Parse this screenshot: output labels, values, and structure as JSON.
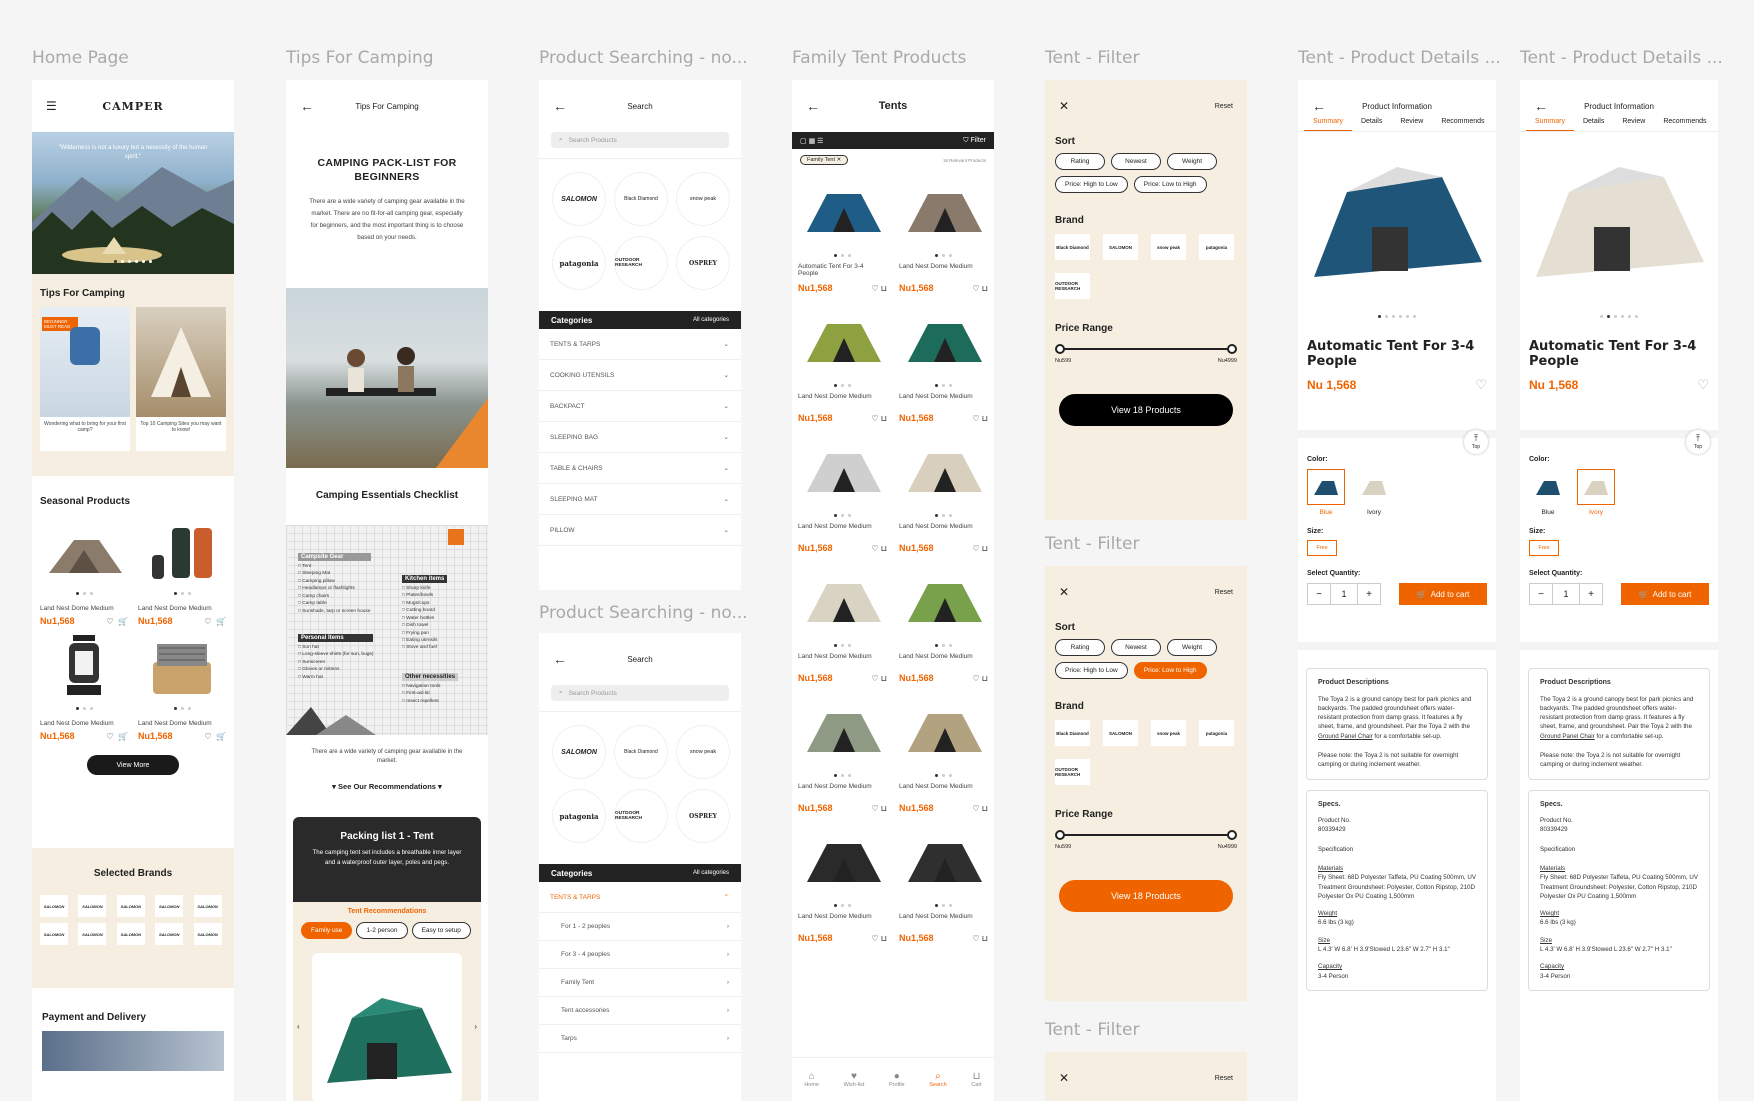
{
  "frame_titles": {
    "home": "Home Page",
    "tips": "Tips For Camping",
    "search1": "Product Searching - no...",
    "family": "Family Tent Products",
    "filter1": "Tent - Filter",
    "details1": "Tent - Product Details ...",
    "details2": "Tent - Product Details ...",
    "search2": "Product Searching - no...",
    "filter2": "Tent - Filter",
    "filter3": "Tent - Filter"
  },
  "home": {
    "logo": "CAMPER",
    "quote": "\"Wilderness is not a luxury but a necessity of the human spirit.\"",
    "tips_title": "Tips For Camping",
    "tip_badge": "BEGINNER MUST READ",
    "tip1_caption": "Wondering what to bring for your first camp?",
    "tip2_caption": "Top 10 Camping Sites you may want to know!",
    "seasonal_title": "Seasonal Products",
    "products": [
      {
        "name": "Land Nest Dome Medium",
        "price": "Nu1,568"
      },
      {
        "name": "Land Nest Dome Medium",
        "price": "Nu1,568"
      },
      {
        "name": "Land Nest Dome Medium",
        "price": "Nu1,568"
      },
      {
        "name": "Land Nest Dome Medium",
        "price": "Nu1,568"
      }
    ],
    "view_more": "View More",
    "brands_title": "Selected Brands",
    "brand_cell": "SALOMON",
    "payment_title": "Payment and Delivery"
  },
  "tips": {
    "header": "Tips For Camping",
    "h1": "CAMPING PACK-LIST FOR BEGINNERS",
    "intro": "There are a wide variety of camping gear available in the market. There are no fit-for-all camping gear, especially for beginners, and the most important thing is to choose based on your needs.",
    "checklist_title": "Camping Essentials Checklist",
    "campsite": "Campsite Gear",
    "campsite_items": [
      "Tent",
      "Sleeping Mat",
      "Camping pillow",
      "Headlamps or flashlights",
      "Camp chairs",
      "Camp table",
      "Sunshade, tarp or screen house"
    ],
    "kitchen": "Kitchen items",
    "kitchen_items": [
      "Sharp knife",
      "Plates/bowls",
      "Mugs/cups",
      "Cutting board",
      "Water bottles",
      "Dish towel",
      "Frying pan",
      "Eating utensils",
      "Stove and fuel"
    ],
    "personal": "Personal Items",
    "personal_items": [
      "Sun hat",
      "Long-sleeve shirts (for sun, bugs)",
      "Sunscreen",
      "Gloves or mittens",
      "Warm hat"
    ],
    "other": "Other necessities",
    "other_items": [
      "Navigation tools",
      "First-aid kit",
      "Insect repellent"
    ],
    "note": "There are a wide variety of camping gear available in the market.",
    "see_rec": "See Our Recommendations",
    "pack_title": "Packing list 1 - Tent",
    "pack_desc": "The camping tent set includes a breathable inner layer and a waterproof outer layer, poles and pegs.",
    "rec_title": "Tent Recommendations",
    "chips": [
      "Family use",
      "1-2 person",
      "Easy to setup"
    ]
  },
  "search": {
    "header": "Search",
    "placeholder": "Search Products",
    "brands": [
      "SALOMON",
      "Black Diamond",
      "snow peak",
      "patagonia",
      "OUTDOOR RESEARCH",
      "OSPREY"
    ],
    "categories": "Categories",
    "all": "All categories",
    "cats": [
      "TENTS & TARPS",
      "COOKING UTENSILS",
      "BACKPACT",
      "SLEEPING BAG",
      "TABLE & CHAIRS",
      "SLEEPING MAT",
      "PILLOW"
    ],
    "sub": [
      "For 1 - 2 peoples",
      "For 3 - 4 peoples",
      "Family Tent",
      "Tent accessories",
      "Tarps"
    ]
  },
  "family": {
    "header": "Tents",
    "filter": "Filter",
    "tag": "Family Tent",
    "count": "16 Relevant Products",
    "first_name": "Automatic Tent For 3-4 People",
    "name": "Land Nest Dome Medium",
    "price": "Nu1,568",
    "nav": [
      "Home",
      "Wish-list",
      "Profile",
      "Search",
      "Cart"
    ]
  },
  "filter": {
    "reset": "Reset",
    "sort": "Sort",
    "sorts": [
      "Rating",
      "Newest",
      "Weight"
    ],
    "sorts2": [
      "Price: High to Low",
      "Price: Low to High"
    ],
    "brand": "Brand",
    "price_range": "Price Range",
    "min": "Nu599",
    "max": "Nu4999",
    "view": "View 18 Products",
    "brands": [
      "Black Diamond",
      "SALOMON",
      "snow peak",
      "patagonia",
      "OUTDOOR RESEARCH"
    ]
  },
  "details": {
    "header": "Product Information",
    "tabs": [
      "Summary",
      "Details",
      "Review",
      "Recommends"
    ],
    "name": "Automatic Tent For 3-4 People",
    "price": "Nu 1,568",
    "top": "Top",
    "color": "Color:",
    "colors": [
      "Blue",
      "Ivory"
    ],
    "size": "Size:",
    "size_val": "Free",
    "qty": "Select Quantity:",
    "qty_val": "1",
    "add": "Add to cart",
    "desc_title": "Product Descriptions",
    "desc": "The Toya 2 is a ground canopy best for park picnics and backyards. The padded groundsheet offers water-resistant protection from damp grass. It features a fly sheet, frame, and groundsheet. Pair the Toya 2 with the",
    "desc_link": "Ground Panel Chair",
    "desc_end": "for a comfortable set-up.",
    "desc_note": "Please note: the Toya 2 is not suitable for overnight camping or during inclement weather.",
    "specs": "Specs.",
    "prod_no_label": "Product No.",
    "prod_no": "80339429",
    "specification": "Specification",
    "materials": "Materials",
    "materials_val": "Fly Sheet: 68D Polyester Taffeta, PU Coating 500mm, UV Treatment Groundsheet: Polyester, Cotton Ripstop, 210D Polyester Ox PU Coating 1,500mm",
    "weight": "Weight",
    "weight_val": "6.6 lbs (3 kg)",
    "size_label": "Size",
    "size_spec": "L 4.3' W 6.8' H 3.9'Stowed L 23.6\" W 2.7\" H 3.1\"",
    "capacity": "Capacity",
    "capacity_val": "3-4 Person"
  }
}
